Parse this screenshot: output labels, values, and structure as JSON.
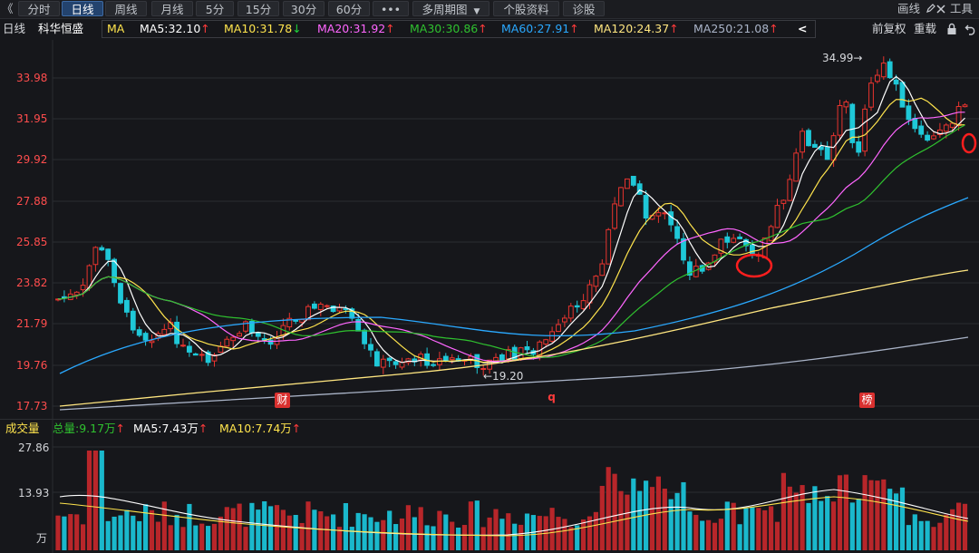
{
  "toolbar": {
    "back_icon": "double-chevron-left-icon",
    "back_glyph": "《",
    "tabs": [
      "分时",
      "日线",
      "周线",
      "月线",
      "5分",
      "15分",
      "30分",
      "60分",
      "•••",
      "多周期图",
      "个股资料",
      "诊股"
    ],
    "active_tab": "日线",
    "multi_dropdown_glyph": "▼",
    "draw_label": "画线",
    "draw_icon": "pencil-icon",
    "tools_label": "工具",
    "tools_icon": "close-icon"
  },
  "subbar": {
    "period": "日线",
    "stock_name": "科华恒盛",
    "indicator": "MA",
    "ma": [
      {
        "label": "MA5:32.10",
        "dir": "↑",
        "color": "#ffffff"
      },
      {
        "label": "MA10:31.78",
        "dir": "↓",
        "color": "#ffe44d"
      },
      {
        "label": "MA20:31.92",
        "dir": "↑",
        "color": "#ff66ff"
      },
      {
        "label": "MA30:30.86",
        "dir": "↑",
        "color": "#2fc12f"
      },
      {
        "label": "MA60:27.91",
        "dir": "↑",
        "color": "#2aa9ff"
      },
      {
        "label": "MA120:24.37",
        "dir": "↑",
        "color": "#ffe680"
      },
      {
        "label": "MA250:21.08",
        "dir": "↑",
        "color": "#aab4c8"
      }
    ],
    "collapse_glyph": "<",
    "restore_label": "前复权",
    "rebuild_label": "重载",
    "lock_icon": "lock-icon",
    "undo_icon": "undo-icon"
  },
  "price_axis": [
    "33.98",
    "31.95",
    "29.92",
    "27.88",
    "25.85",
    "23.82",
    "21.79",
    "19.76",
    "17.73"
  ],
  "annotations": {
    "high": "34.99→",
    "low": "←19.20"
  },
  "badges": [
    "财",
    "q",
    "榜"
  ],
  "volume_bar": {
    "title": "成交量",
    "total": "总量:9.17万",
    "total_dir": "↑",
    "ma5": "MA5:7.43万",
    "ma5_dir": "↑",
    "ma10": "MA10:7.74万",
    "ma10_dir": "↑"
  },
  "volume_axis": [
    "27.86",
    "13.93",
    "万"
  ],
  "colors": {
    "up": "#e8342f",
    "down": "#1fc8d8",
    "ma5": "#ffffff",
    "ma10": "#ffe44d",
    "ma20": "#ff66ff",
    "ma30": "#2fc12f",
    "ma60": "#2aa9ff",
    "ma120": "#ffe680",
    "ma250": "#aab4c8"
  }
}
